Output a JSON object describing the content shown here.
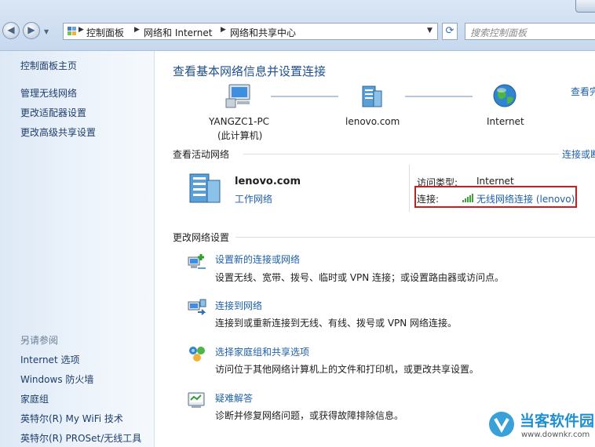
{
  "nav": {
    "breadcrumbs": [
      "控制面板",
      "网络和 Internet",
      "网络和共享中心"
    ],
    "search_placeholder": "搜索控制面板"
  },
  "sidebar": {
    "items": [
      "控制面板主页",
      "管理无线网络",
      "更改适配器设置",
      "更改高级共享设置"
    ],
    "see_also_heading": "另请参阅",
    "see_also": [
      "Internet 选项",
      "Windows 防火墙",
      "家庭组",
      "英特尔(R) My WiFi 技术",
      "英特尔(R) PROSet/无线工具"
    ]
  },
  "main": {
    "title": "查看基本网络信息并设置连接",
    "view_full_map": "查看完",
    "map": {
      "computer_name": "YANGZC1-PC",
      "computer_sub": "(此计算机)",
      "network": "lenovo.com",
      "internet": "Internet"
    },
    "active_heading": "查看活动网络",
    "connect_or_disconnect": "连接或断",
    "active": {
      "name": "lenovo.com",
      "type": "工作网络",
      "access_label": "访问类型:",
      "access_value": "Internet",
      "conn_label": "连接:",
      "conn_value": "无线网络连接 (lenovo)"
    },
    "change_heading": "更改网络设置",
    "tasks": [
      {
        "title": "设置新的连接或网络",
        "desc": "设置无线、宽带、拨号、临时或 VPN 连接；或设置路由器或访问点。",
        "icon": "new-connection-icon"
      },
      {
        "title": "连接到网络",
        "desc": "连接到或重新连接到无线、有线、拨号或 VPN 网络连接。",
        "icon": "connect-network-icon"
      },
      {
        "title": "选择家庭组和共享选项",
        "desc": "访问位于其他网络计算机上的文件和打印机，或更改共享设置。",
        "icon": "homegroup-icon"
      },
      {
        "title": "疑难解答",
        "desc": "诊断并修复网络问题，或获得故障排除信息。",
        "icon": "troubleshoot-icon"
      }
    ]
  },
  "watermark": {
    "brand": "当客软件园",
    "url": "www.downkr.com"
  },
  "colors": {
    "link": "#1f5fa8",
    "title": "#1f4f91",
    "highlight": "#d11a1a",
    "signal": "#3aa63a"
  }
}
